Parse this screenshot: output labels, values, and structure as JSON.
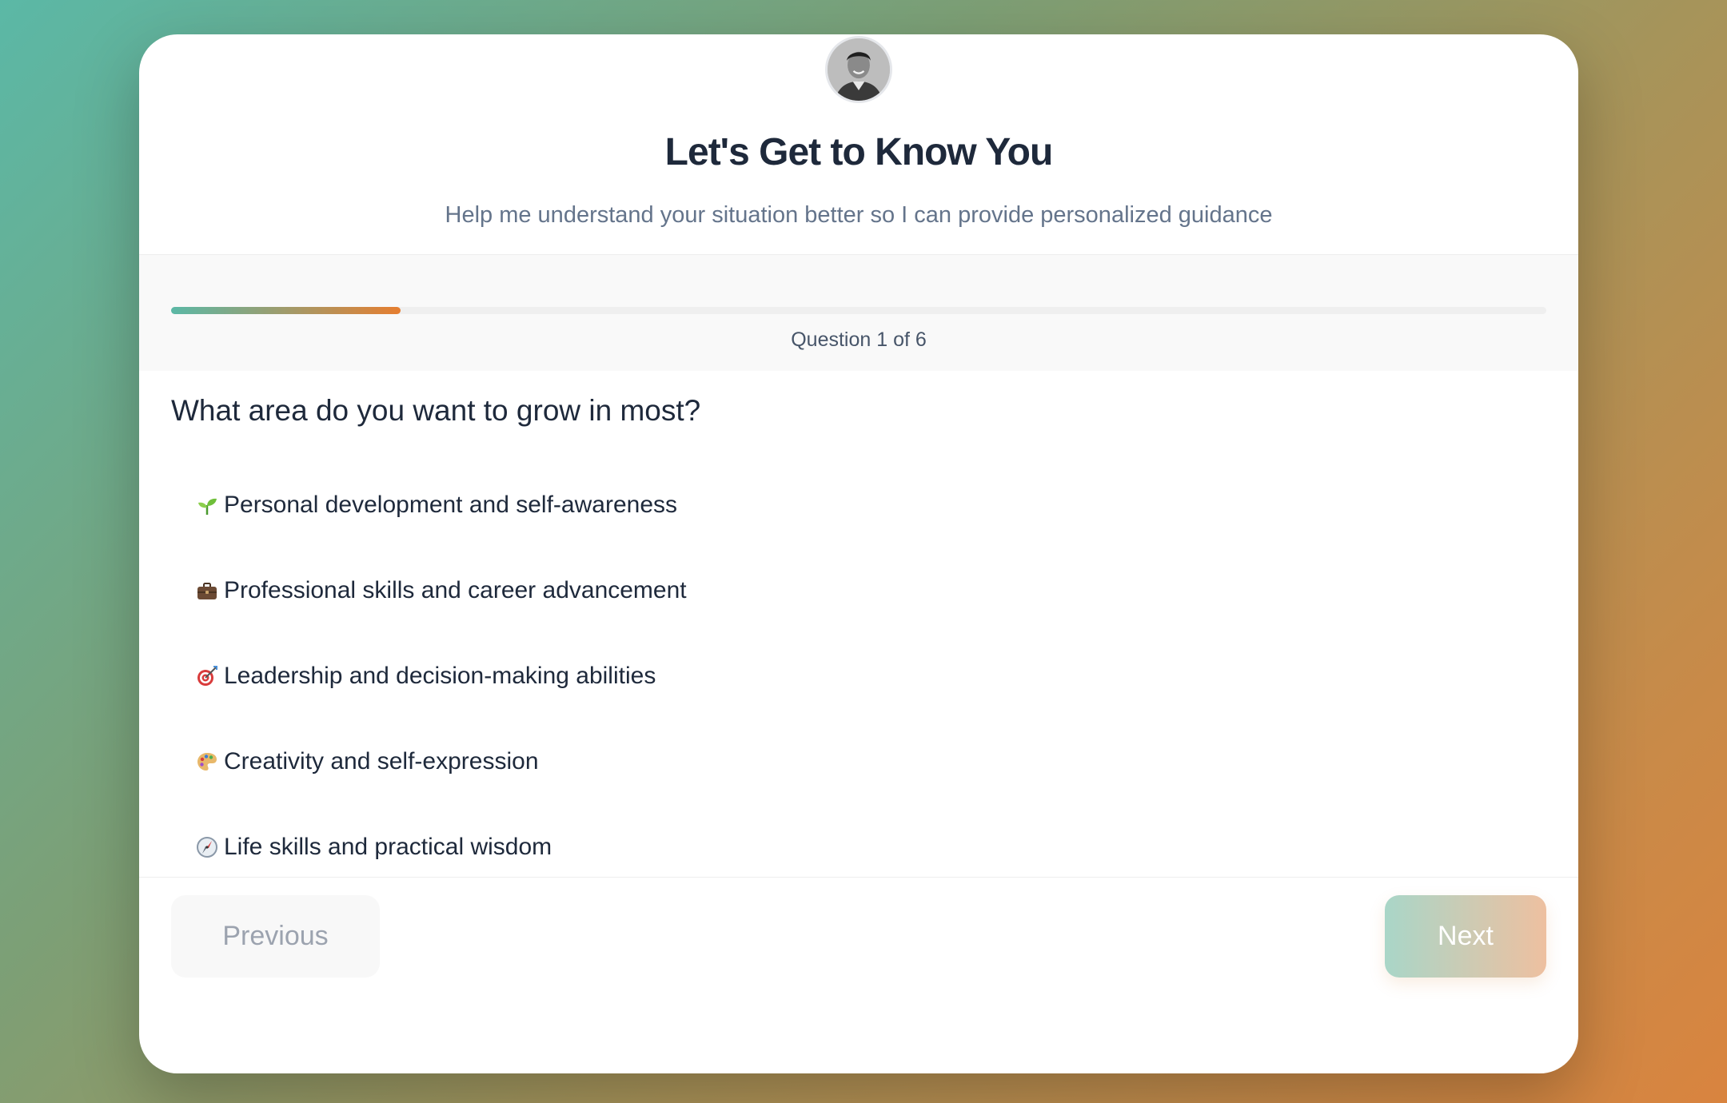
{
  "header": {
    "title": "Let's Get to Know You",
    "subtitle": "Help me understand your situation better so I can provide personalized guidance"
  },
  "progress": {
    "label": "Question 1 of 6",
    "fraction": 0.167,
    "gradient_start": "#5bb8a6",
    "gradient_end": "#e67e30"
  },
  "question": {
    "text": "What area do you want to grow in most?",
    "options": [
      {
        "icon": "seedling-icon",
        "label": "Personal development and self-awareness"
      },
      {
        "icon": "briefcase-icon",
        "label": "Professional skills and career advancement"
      },
      {
        "icon": "target-icon",
        "label": "Leadership and decision-making abilities"
      },
      {
        "icon": "palette-icon",
        "label": "Creativity and self-expression"
      },
      {
        "icon": "compass-icon",
        "label": "Life skills and practical wisdom"
      }
    ]
  },
  "footer": {
    "previous_label": "Previous",
    "next_label": "Next"
  },
  "colors": {
    "accent_teal": "#5bb8a6",
    "accent_orange": "#d9843f",
    "text_dark": "#1e293b",
    "text_muted": "#64748b"
  }
}
